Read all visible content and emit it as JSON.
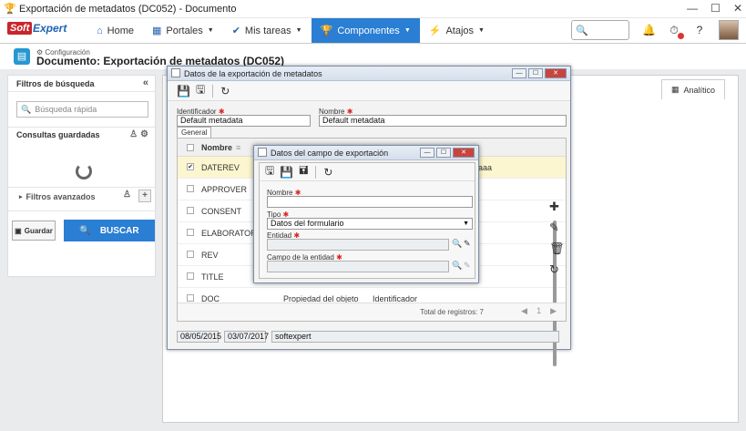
{
  "window": {
    "title": "Exportación de metadatos (DC052) - Documento"
  },
  "nav": {
    "logo_soft": "Soft",
    "logo_expert": "Expert",
    "items": [
      {
        "label": "Home"
      },
      {
        "label": "Portales"
      },
      {
        "label": "Mis tareas"
      },
      {
        "label": "Componentes"
      },
      {
        "label": "Atajos"
      }
    ]
  },
  "header": {
    "breadcrumb": "Configuración",
    "title": "Documento: Exportación de metadatos (DC052)"
  },
  "left_panel": {
    "title": "Filtros de búsqueda",
    "search_placeholder": "Búsqueda rápida",
    "saved_queries": "Consultas guardadas",
    "advanced_filters": "Filtros avanzados",
    "save_label": "Guardar",
    "search_label": "BUSCAR"
  },
  "main": {
    "tab_analitico": "Analítico"
  },
  "dialog1": {
    "title": "Datos de la exportación de metadatos",
    "identificador_label": "Identificador",
    "identificador_value": "Default metadata",
    "nombre_label": "Nombre",
    "nombre_value": "Default metadata",
    "tab_general": "General",
    "grid": {
      "col_nombre": "Nombre",
      "rows": [
        {
          "name": "DATEREV",
          "checked": true,
          "c3": "",
          "c4": "aaa"
        },
        {
          "name": "APPROVER",
          "checked": false
        },
        {
          "name": "CONSENT",
          "checked": false
        },
        {
          "name": "ELABORATOR",
          "checked": false
        },
        {
          "name": "REV",
          "checked": false
        },
        {
          "name": "TITLE",
          "checked": false
        },
        {
          "name": "DOC",
          "checked": false,
          "c3": "Propiedad del objeto",
          "c4": "Identificador"
        }
      ],
      "total": "Total de registros: 7"
    },
    "bottom": {
      "created": "08/05/2015",
      "updated": "03/07/2017",
      "updated_by": "softexpert"
    }
  },
  "dialog2": {
    "title": "Datos del campo de exportación",
    "nombre_label": "Nombre",
    "nombre_value": "",
    "tipo_label": "Tipo",
    "tipo_value": "Datos del formulario",
    "entidad_label": "Entidad",
    "campo_label": "Campo de la entidad"
  },
  "colors": {
    "accent": "#2a7ed3",
    "selected_row": "#fbf6cf",
    "required": "#d22222"
  }
}
